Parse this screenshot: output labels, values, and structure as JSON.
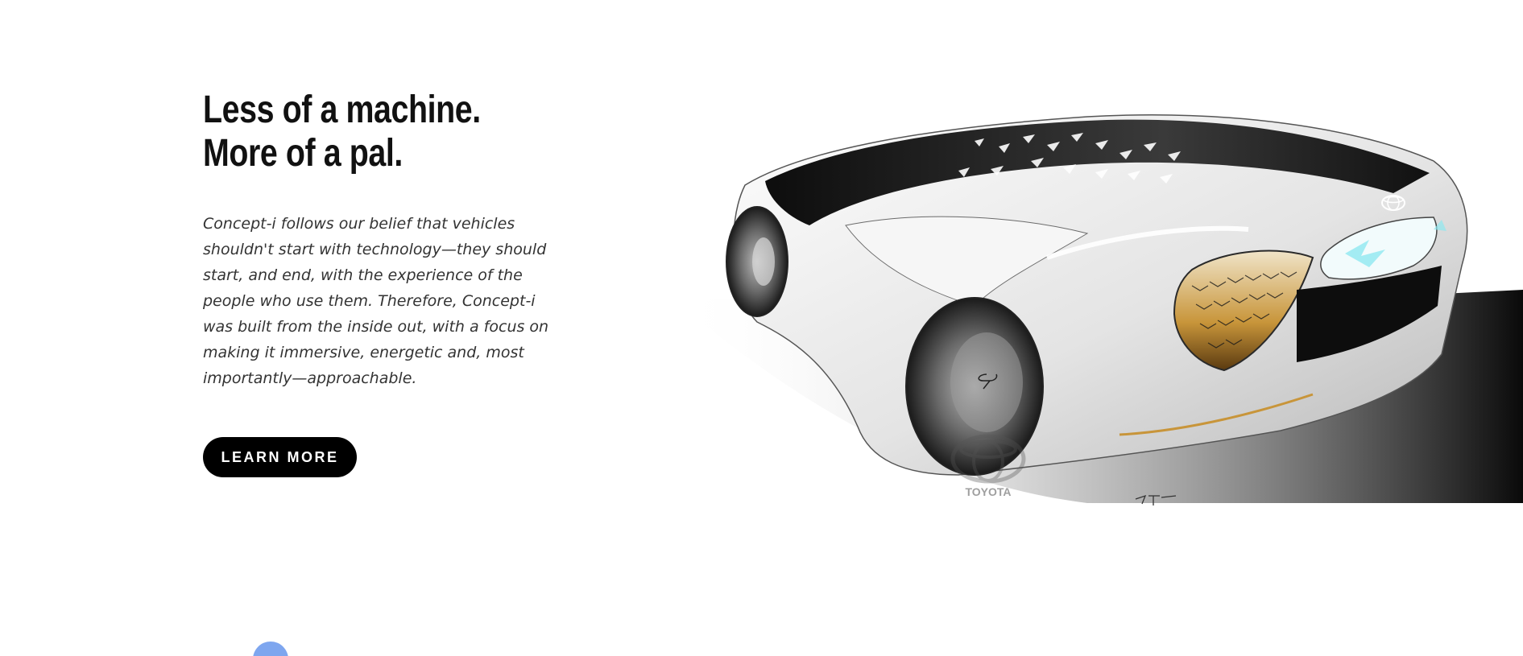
{
  "hero": {
    "headline_line1": "Less of a machine.",
    "headline_line2": "More of a pal.",
    "body": "Concept-i follows our belief that vehicles shouldn't start with technology—they should start, and end, with the experience of the people who use them. Therefore, Concept-i was built from the inside out, with a focus on making it immersive, energetic and, most importantly—approachable.",
    "cta_label": "LEARN MORE"
  },
  "illustration": {
    "brand_label": "TOYOTA",
    "icon": "concept-car-sketch"
  },
  "colors": {
    "text": "#111111",
    "button_bg": "#000000",
    "button_text": "#ffffff",
    "accent_blue": "#7ea6ef",
    "accent_gold": "#c8953a",
    "accent_cyan": "#8fe8f0"
  }
}
